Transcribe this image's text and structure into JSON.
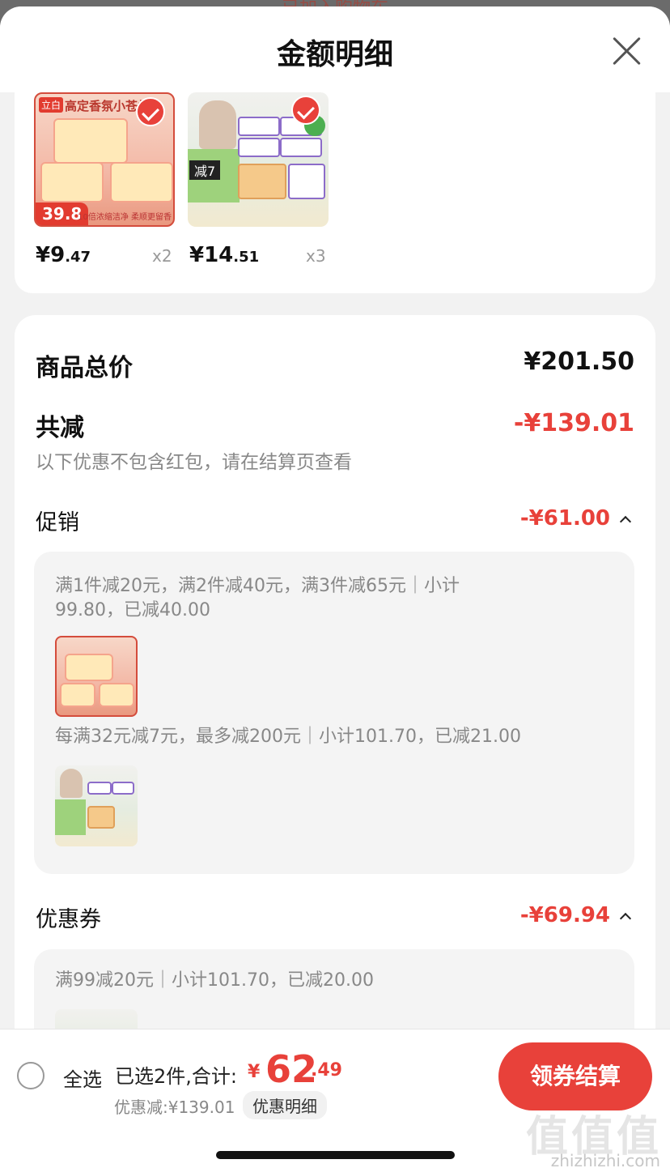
{
  "backdrop": {
    "text": "已加入购物车"
  },
  "header": {
    "title": "金额明细"
  },
  "products": [
    {
      "price_int": "¥9",
      "price_dec": ".47",
      "qty": "x2",
      "thumb_brand": "立白",
      "thumb_head": "高定香氛小苍兰",
      "thumb_price": "39.8",
      "thumb_foot": "10倍浓缩洁净 柔顺更留香"
    },
    {
      "price_int": "¥14",
      "price_dec": ".51",
      "qty": "x3",
      "thumb_promo": "减7"
    }
  ],
  "summary": {
    "total_label": "商品总价",
    "total_value": "¥201.50",
    "discount_label": "共减",
    "discount_value": "-¥139.01",
    "note": "以下优惠不包含红包，请在结算页查看",
    "promo": {
      "label": "促销",
      "value": "-¥61.00",
      "line1": "满1件减20元，满2件减40元，满3件减65元｜小计",
      "line2": "99.80，已减40.00",
      "line3": "每满32元减7元，最多减200元｜小计101.70，已减21.00"
    },
    "coupon": {
      "label": "优惠券",
      "value": "-¥69.94",
      "line1": "满99减20元｜小计101.70，已减20.00"
    }
  },
  "bottom": {
    "select_all": "全选",
    "selected": "已选2件,合计:",
    "currency": "¥",
    "total_int": "62",
    "total_dec": ".49",
    "discount": "优惠减:¥139.01",
    "discount_link": "优惠明细",
    "checkout": "领券结算"
  },
  "watermark": {
    "main": "值值值",
    "sub": "zhizhizhi.com"
  },
  "colors": {
    "accent": "#e8413a",
    "text": "#111111",
    "muted": "#888888"
  }
}
